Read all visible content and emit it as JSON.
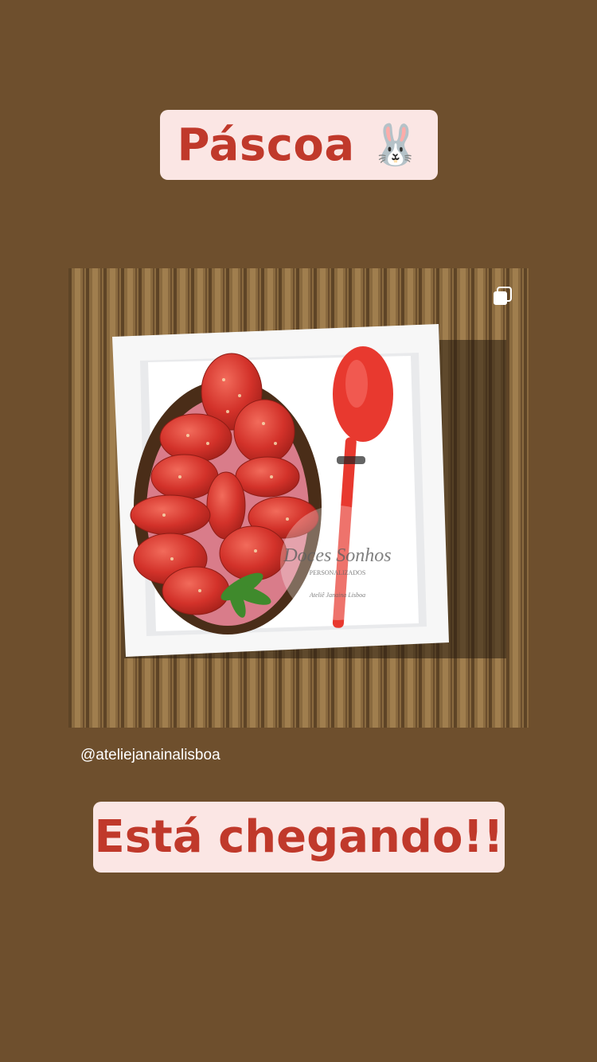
{
  "title_sticker": {
    "text": "Páscoa",
    "emoji": "🐰"
  },
  "post": {
    "watermark": {
      "brand": "Doces Sonhos",
      "subtitle": "PERSONALIZADOS",
      "author": "Ateliê Janaina Lisboa"
    },
    "icon": "multiple-photos-icon",
    "handle": "@ateliejanainalisboa"
  },
  "bottom_sticker": {
    "text": "Está chegando!!"
  },
  "colors": {
    "background": "#6e4f2d",
    "sticker_bg": "#fbe6e4",
    "sticker_text": "#c0392b"
  }
}
